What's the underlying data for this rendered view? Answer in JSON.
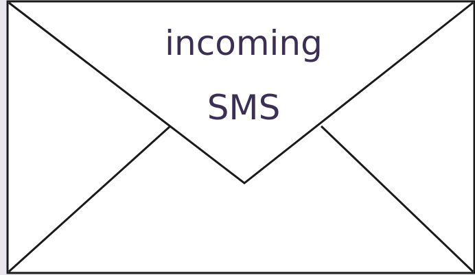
{
  "envelope": {
    "text_line1": "incoming",
    "text_line2": "SMS"
  },
  "colors": {
    "background": "#e9e6f0",
    "envelope_fill": "#ffffff",
    "stroke": "#1a1a1a",
    "text": "#3b2f56"
  }
}
